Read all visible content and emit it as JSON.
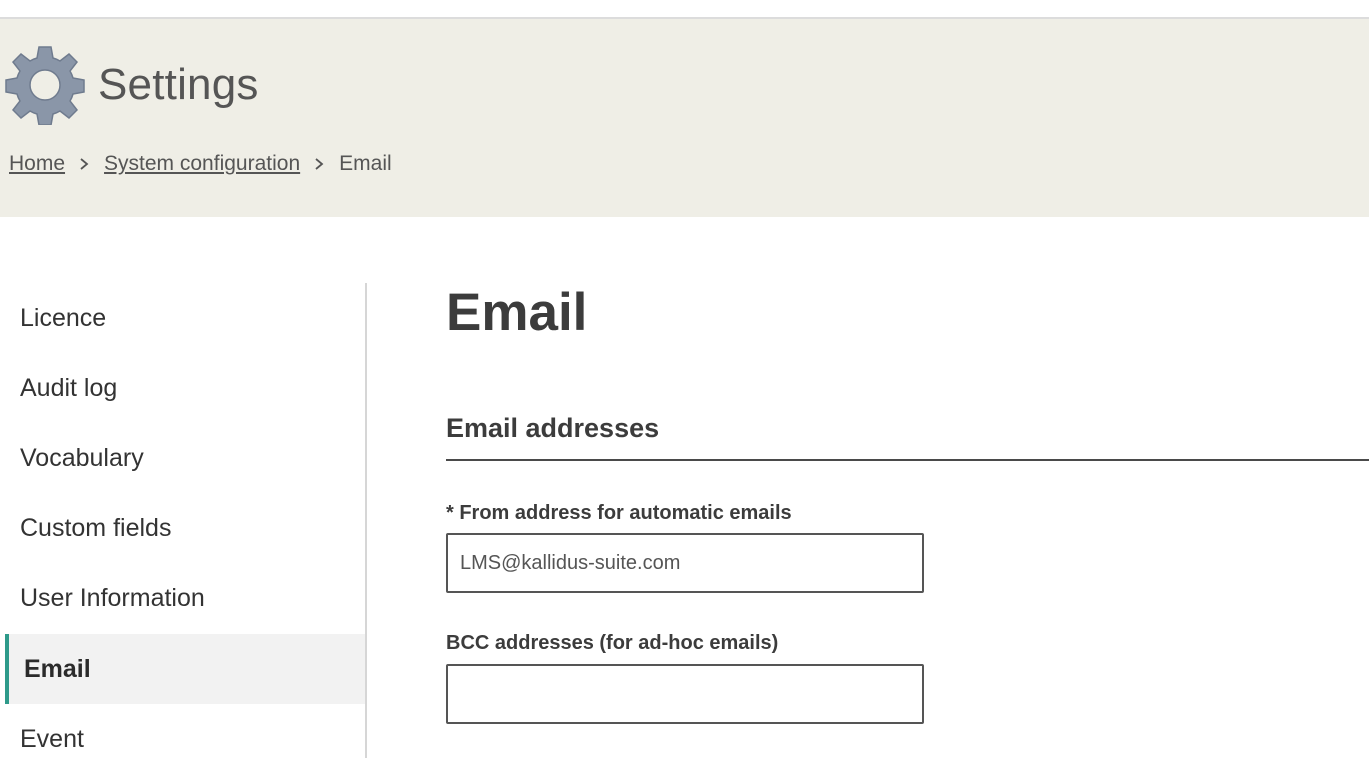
{
  "header": {
    "title": "Settings",
    "icon": "gear-icon",
    "icon_color": "#8a96a8",
    "background": "#efeee6"
  },
  "breadcrumb": {
    "items": [
      {
        "label": "Home",
        "link": true
      },
      {
        "label": "System configuration",
        "link": true
      },
      {
        "label": "Email",
        "link": false
      }
    ]
  },
  "sidebar": {
    "items": [
      {
        "label": "Licence",
        "active": false
      },
      {
        "label": "Audit log",
        "active": false
      },
      {
        "label": "Vocabulary",
        "active": false
      },
      {
        "label": "Custom fields",
        "active": false
      },
      {
        "label": "User Information",
        "active": false
      },
      {
        "label": "Email",
        "active": true
      },
      {
        "label": "Event",
        "active": false
      }
    ],
    "active_accent": "#2e9a8a"
  },
  "main": {
    "title": "Email",
    "section_title": "Email addresses",
    "fields": {
      "from_address": {
        "label": "* From address for automatic emails",
        "value": "LMS@kallidus-suite.com"
      },
      "bcc_addresses": {
        "label": "BCC addresses (for ad-hoc emails)",
        "value": ""
      }
    }
  }
}
